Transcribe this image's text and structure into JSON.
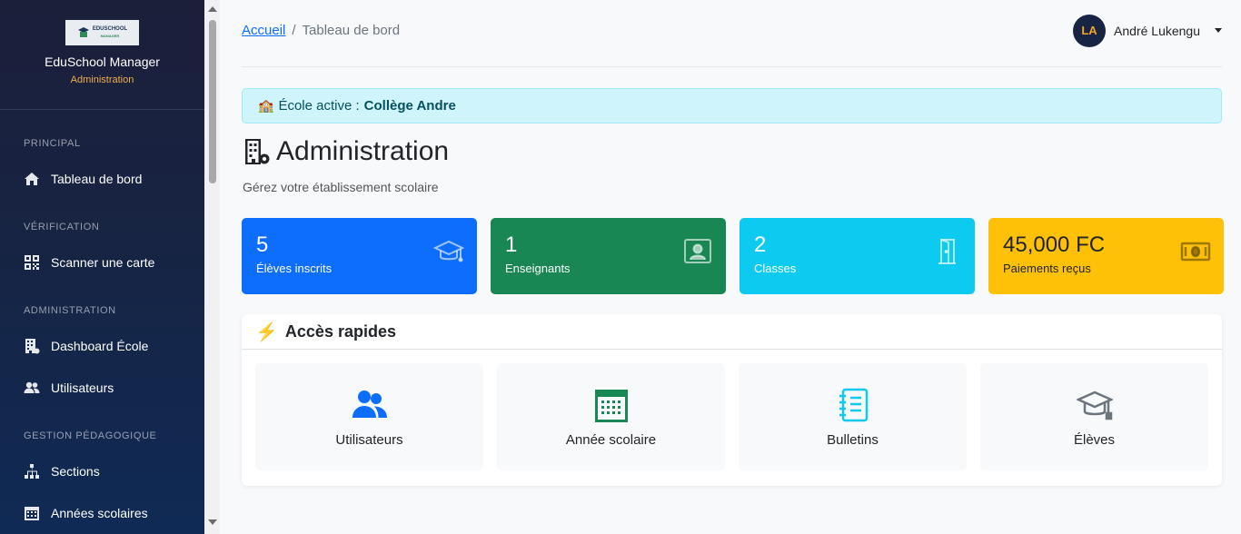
{
  "brand": {
    "logo_text": "EDUSCHOOL",
    "logo_subtext": "MANAGER",
    "name": "EduSchool Manager",
    "role": "Administration"
  },
  "sidebar": {
    "sections": [
      {
        "title": "PRINCIPAL",
        "items": [
          {
            "label": "Tableau de bord",
            "icon": "home-icon"
          }
        ]
      },
      {
        "title": "VÉRIFICATION",
        "items": [
          {
            "label": "Scanner une carte",
            "icon": "qr-code-icon"
          }
        ]
      },
      {
        "title": "ADMINISTRATION",
        "items": [
          {
            "label": "Dashboard École",
            "icon": "building-icon"
          },
          {
            "label": "Utilisateurs",
            "icon": "users-icon"
          }
        ]
      },
      {
        "title": "GESTION PÉDAGOGIQUE",
        "items": [
          {
            "label": "Sections",
            "icon": "sitemap-icon"
          },
          {
            "label": "Années scolaires",
            "icon": "calendar-icon"
          }
        ]
      }
    ]
  },
  "breadcrumb": {
    "home": "Accueil",
    "separator": "/",
    "current": "Tableau de bord"
  },
  "user": {
    "initials": "LA",
    "name": "André Lukengu"
  },
  "alert": {
    "icon": "🏫",
    "prefix": "École active :",
    "school": "Collège Andre"
  },
  "page": {
    "title": "Administration",
    "subtitle": "Gérez votre établissement scolaire"
  },
  "stats": [
    {
      "value": "5",
      "label": "Élèves inscrits",
      "icon": "graduation-cap-icon",
      "color": "#0d6efd"
    },
    {
      "value": "1",
      "label": "Enseignants",
      "icon": "teacher-icon",
      "color": "#198754"
    },
    {
      "value": "2",
      "label": "Classes",
      "icon": "door-icon",
      "color": "#0dcaf0"
    },
    {
      "value": "45,000 FC",
      "label": "Paiements reçus",
      "icon": "money-icon",
      "color": "#ffc107"
    }
  ],
  "quick_access": {
    "title": "Accès rapides",
    "items": [
      {
        "label": "Utilisateurs",
        "icon": "users-icon",
        "color": "#0d6efd"
      },
      {
        "label": "Année scolaire",
        "icon": "calendar-icon",
        "color": "#198754"
      },
      {
        "label": "Bulletins",
        "icon": "journal-icon",
        "color": "#0dcaf0"
      },
      {
        "label": "Élèves",
        "icon": "graduation-cap-icon",
        "color": "#6c757d"
      }
    ]
  }
}
